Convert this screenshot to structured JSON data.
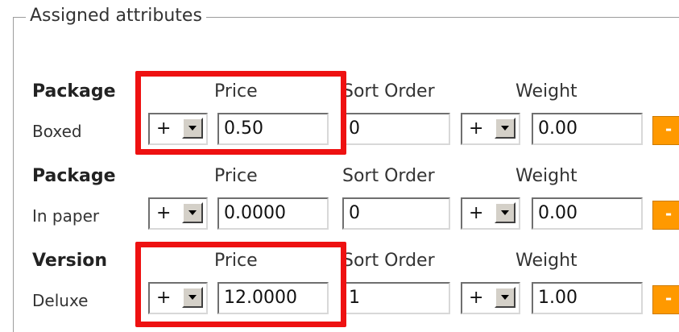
{
  "fieldset": {
    "legend": "Assigned attributes"
  },
  "columns": {
    "price": "Price",
    "sort_order": "Sort Order",
    "weight": "Weight"
  },
  "rows": [
    {
      "attribute": "Package",
      "value": "Boxed",
      "price_prefix": "+",
      "price": "0.50",
      "sort_order": "0",
      "weight_prefix": "+",
      "weight": "0.00",
      "remove_label": "-"
    },
    {
      "attribute": "Package",
      "value": "In paper",
      "price_prefix": "+",
      "price": "0.0000",
      "sort_order": "0",
      "weight_prefix": "+",
      "weight": "0.00",
      "remove_label": "-"
    },
    {
      "attribute": "Version",
      "value": "Deluxe",
      "price_prefix": "+",
      "price": "12.0000",
      "sort_order": "1",
      "weight_prefix": "+",
      "weight": "1.00",
      "remove_label": "-"
    }
  ],
  "colors": {
    "highlight": "#ee1111",
    "remove_button": "#ff9900"
  }
}
